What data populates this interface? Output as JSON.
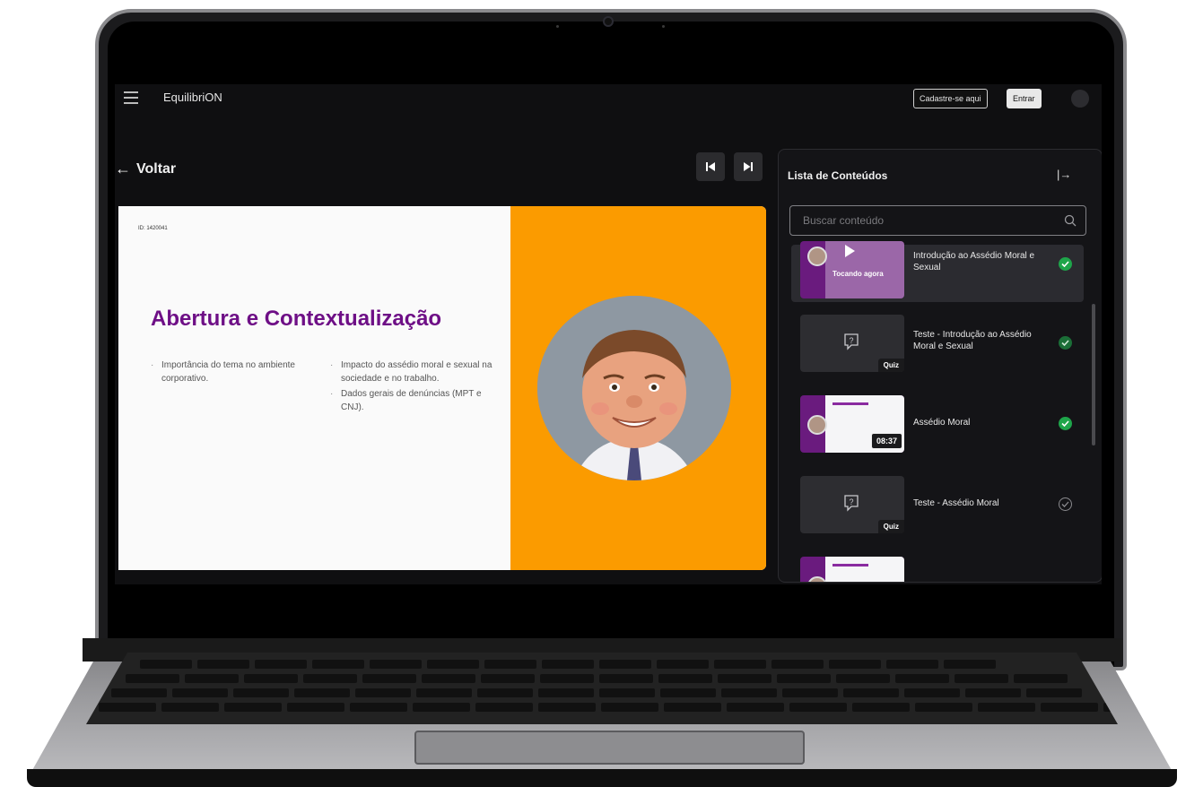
{
  "header": {
    "brand": "EquilibriON",
    "register_button": "Cadastre-se aqui",
    "login_button": "Entrar"
  },
  "toolbar": {
    "back_label": "Voltar"
  },
  "slide": {
    "id_text": "ID: 1420041",
    "title": "Abertura e Contextualização",
    "bullets_col1": [
      "Importância do tema no ambiente corporativo."
    ],
    "bullets_col2": [
      "Impacto do assédio moral e sexual na sociedade e no trabalho.",
      "Dados gerais de denúncias (MPT e CNJ)."
    ],
    "colors": {
      "title": "#6e0f86",
      "panel_right": "#fb9b00"
    }
  },
  "content_list": {
    "title": "Lista de Conteúdos",
    "search_placeholder": "Buscar conteúdo",
    "items": [
      {
        "title": "Introdução ao Assédio Moral e Sexual",
        "type": "video",
        "status_label": "Tocando agora",
        "completed": true
      },
      {
        "title": "Teste - Introdução ao Assédio Moral e Sexual",
        "type": "quiz",
        "badge": "Quiz",
        "completed": true
      },
      {
        "title": "Assédio Moral",
        "type": "video",
        "badge": "08:37",
        "completed": true
      },
      {
        "title": "Teste - Assédio Moral",
        "type": "quiz",
        "badge": "Quiz",
        "completed": false
      }
    ]
  },
  "icons": [
    "menu-icon",
    "arrow-left-icon",
    "skip-previous-icon",
    "skip-next-icon",
    "collapse-panel-icon",
    "search-icon",
    "quiz-icon",
    "play-icon",
    "check-icon"
  ]
}
